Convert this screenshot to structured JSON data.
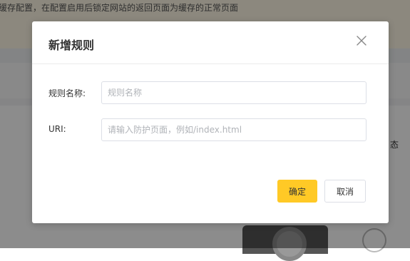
{
  "background": {
    "notice": "缓存配置，在配置启用后锁定网站的返回页面为缓存的正常页面",
    "right_text": "态"
  },
  "dialog": {
    "title": "新增规则",
    "fields": [
      {
        "label": "规则名称:",
        "value": "",
        "placeholder": "规则名称"
      },
      {
        "label": "URI:",
        "value": "",
        "placeholder": "请输入防护页面，例如/index.html"
      }
    ],
    "buttons": {
      "ok": "确定",
      "cancel": "取消"
    },
    "icons": {
      "close": "close-icon"
    },
    "colors": {
      "primary": "#ffc926",
      "overlay": "rgba(0,0,0,0.45)"
    }
  }
}
